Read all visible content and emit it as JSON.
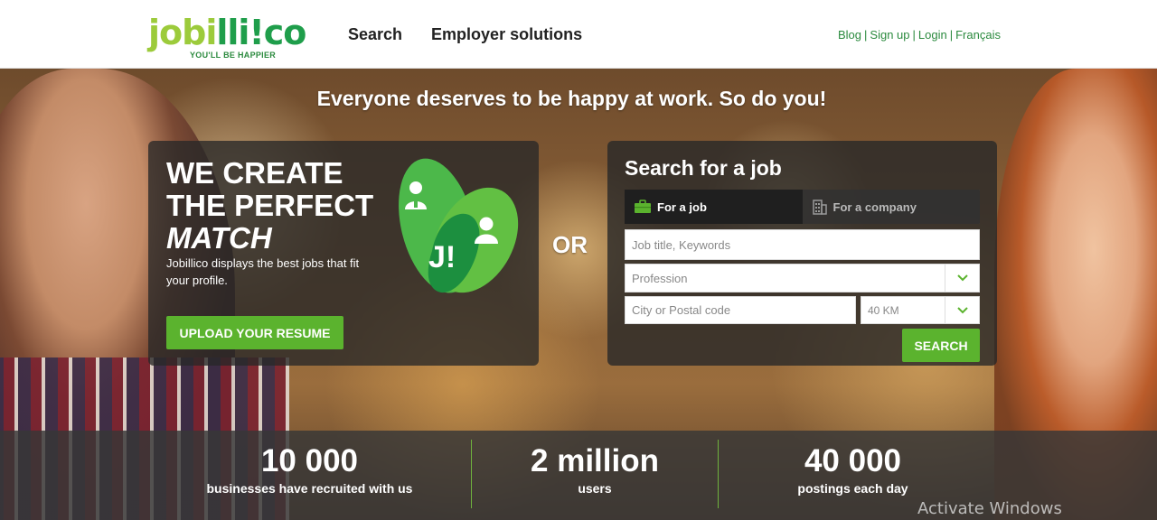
{
  "header": {
    "logo_text_a": "jobi",
    "logo_text_b": "lli",
    "logo_text_c": "!co",
    "logo_tagline": "YOU'LL BE HAPPIER",
    "nav": [
      "Search",
      "Employer solutions"
    ],
    "links": [
      "Blog",
      "Sign up",
      "Login",
      "Français"
    ]
  },
  "hero": {
    "tagline": "Everyone deserves to be happy at work. So do you!",
    "left_panel": {
      "title_lines": [
        "WE CREATE",
        "THE PERFECT",
        "MATCH"
      ],
      "description": "Jobillico displays the best jobs that fit your profile.",
      "upload_button": "UPLOAD YOUR RESUME",
      "graphic_label": "J!"
    },
    "or_label": "OR",
    "right_panel": {
      "title": "Search for a job",
      "tabs": [
        {
          "label": "For a job",
          "icon": "briefcase-icon"
        },
        {
          "label": "For a company",
          "icon": "building-icon"
        }
      ],
      "keywords_placeholder": "Job title, Keywords",
      "profession_value": "Profession",
      "city_placeholder": "City or Postal code",
      "radius_value": "40 KM",
      "search_button": "SEARCH"
    }
  },
  "stats": [
    {
      "value": "10 000",
      "label": "businesses have recruited with us"
    },
    {
      "value": "2 million",
      "label": "users"
    },
    {
      "value": "40 000",
      "label": "postings each day"
    }
  ],
  "watermark": "Activate Windows",
  "colors": {
    "brand_green": "#5bb32e",
    "dark_green": "#1f9e4b",
    "light_green": "#9ccb3b"
  }
}
